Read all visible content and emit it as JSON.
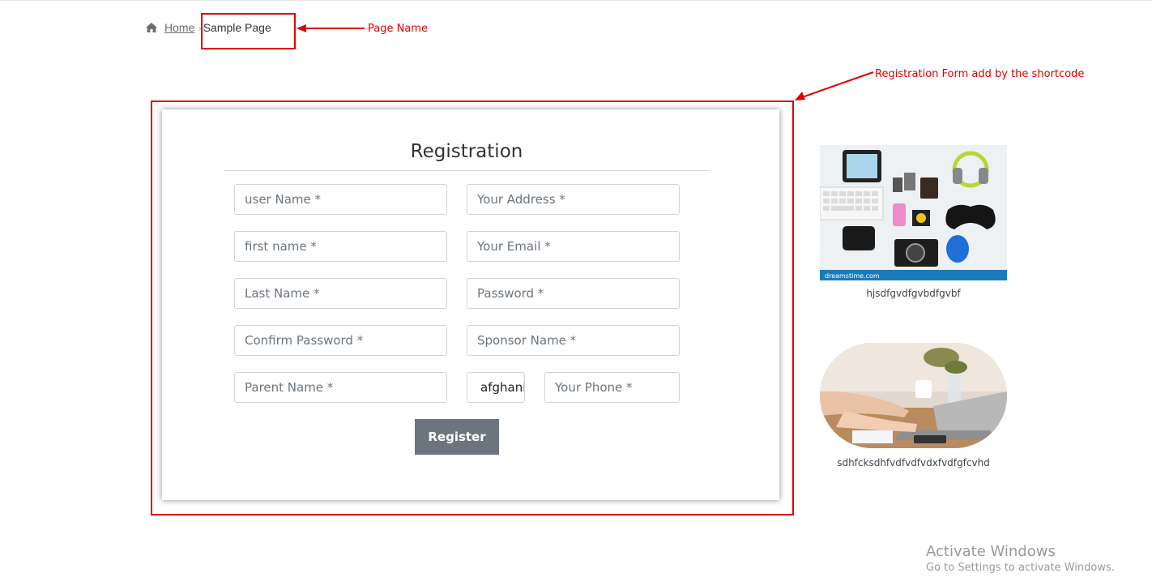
{
  "breadcrumb": {
    "home_label": "Home",
    "separator": "›",
    "current": "Sample Page"
  },
  "annotations": {
    "page_name": "Page Name",
    "registration_form": "Registration Form add by the shortcode",
    "color": "#e00000"
  },
  "form": {
    "title": "Registration",
    "fields": {
      "user_name": "user Name *",
      "address": "Your Address *",
      "first_name": "first name *",
      "email": "Your Email *",
      "last_name": "Last Name *",
      "password": "Password *",
      "confirm_password": "Confirm Password *",
      "sponsor_name": "Sponsor Name *",
      "parent_name": "Parent Name *",
      "phone": "Your Phone *"
    },
    "country_value": "afghanistan",
    "register_label": "Register",
    "button_color": "#6c757d"
  },
  "sidebar": {
    "image1_caption": "hjsdfgvdfgvbdfgvbf",
    "image2_caption": "sdhfcksdhfvdfvdfvdxfvdfgfcvhd",
    "image1_watermark": "dreamstime.com"
  },
  "watermark": {
    "title": "Activate Windows",
    "subtitle": "Go to Settings to activate Windows."
  }
}
